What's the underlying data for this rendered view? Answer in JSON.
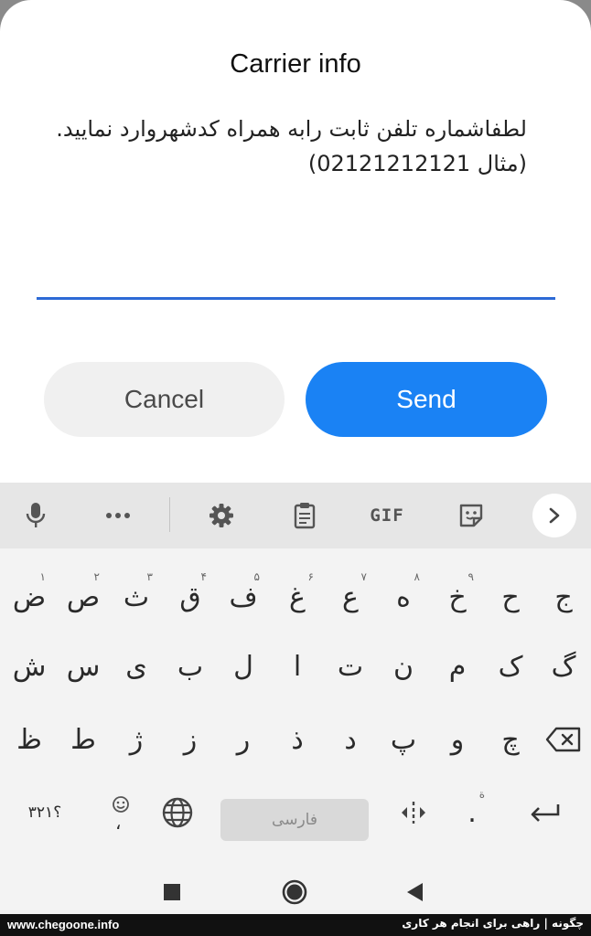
{
  "dialog": {
    "title": "Carrier info",
    "message_line1": "لطفاشماره تلفن ثابت رابه همراه کدشهروارد نمایید.",
    "message_line2": "(مثال 02121212121)",
    "input_value": "",
    "cancel_label": "Cancel",
    "send_label": "Send",
    "accent_color": "#1a82f4"
  },
  "keyboard": {
    "toolbar": {
      "items": [
        "mic-icon",
        "more-icon",
        "gear-icon",
        "clipboard-icon",
        "gif",
        "sticker-icon",
        "chevron-right-icon"
      ],
      "gif_label": "GIF"
    },
    "row1": [
      {
        "char": "ض",
        "hint": "۱"
      },
      {
        "char": "ص",
        "hint": "۲"
      },
      {
        "char": "ث",
        "hint": "۳"
      },
      {
        "char": "ق",
        "hint": "۴"
      },
      {
        "char": "ف",
        "hint": "۵"
      },
      {
        "char": "غ",
        "hint": "۶"
      },
      {
        "char": "ع",
        "hint": "۷"
      },
      {
        "char": "ه",
        "hint": "۸"
      },
      {
        "char": "خ",
        "hint": "۹"
      },
      {
        "char": "ح",
        "hint": ""
      },
      {
        "char": "ج",
        "hint": ""
      }
    ],
    "row2": [
      "ش",
      "س",
      "ی",
      "ب",
      "ل",
      "ا",
      "ت",
      "ن",
      "م",
      "ک",
      "گ"
    ],
    "row3": [
      "ظ",
      "ط",
      "ژ",
      "ز",
      "ر",
      "ذ",
      "د",
      "پ",
      "و",
      "چ"
    ],
    "row4": {
      "symbols_label": "؟۳۲۱",
      "comma_label": "،",
      "space_label": "فارسی",
      "period_label": ".",
      "period_hint": "ة"
    }
  },
  "footer": {
    "left": "www.chegoone.info",
    "right": "چگونه | راهی برای انجام هر کاری"
  }
}
